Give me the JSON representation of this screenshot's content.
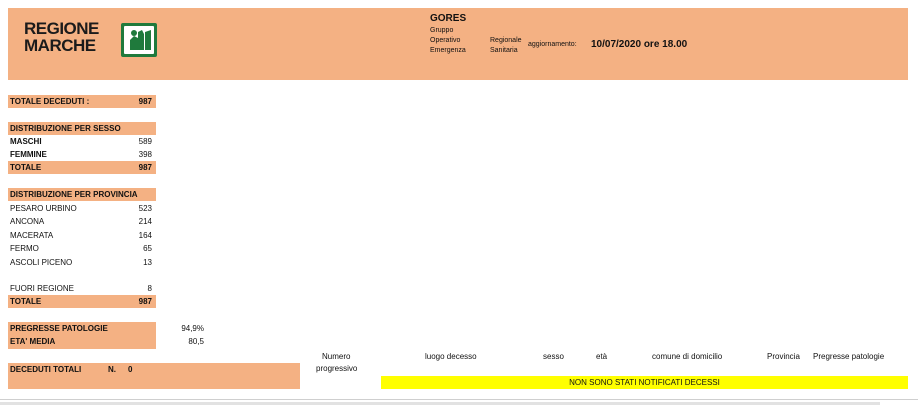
{
  "header": {
    "logo_line1": "REGIONE",
    "logo_line2": "MARCHE",
    "title": "GORES",
    "col1": [
      "Gruppo",
      "Operativo",
      "Emergenza"
    ],
    "col2": [
      "Regionale",
      "Sanitaria"
    ],
    "update_label": "aggiornamento:",
    "update_value": "10/07/2020 ore 18.00"
  },
  "totale_deceduti": {
    "label": "TOTALE DECEDUTI :",
    "value": "987"
  },
  "sesso": {
    "title": "DISTRIBUZIONE PER SESSO",
    "rows": [
      {
        "label": "MASCHI",
        "value": "589"
      },
      {
        "label": "FEMMINE",
        "value": "398"
      }
    ],
    "total": {
      "label": "TOTALE",
      "value": "987"
    }
  },
  "provincia": {
    "title": "DISTRIBUZIONE PER PROVINCIA",
    "rows": [
      {
        "label": "PESARO URBINO",
        "value": "523"
      },
      {
        "label": "ANCONA",
        "value": "214"
      },
      {
        "label": "MACERATA",
        "value": "164"
      },
      {
        "label": "FERMO",
        "value": "65"
      },
      {
        "label": "ASCOLI PICENO",
        "value": "13"
      }
    ],
    "fuori": {
      "label": "FUORI REGIONE",
      "value": "8"
    },
    "total": {
      "label": "TOTALE",
      "value": "987"
    }
  },
  "stats": {
    "patologie": {
      "label": "PREGRESSE PATOLOGIE",
      "value": "94,9%"
    },
    "eta": {
      "label": "ETA' MEDIA",
      "value": "80,5"
    }
  },
  "deceduti_totali": {
    "label": "DECEDUTI TOTALI",
    "n_label": "N.",
    "n_value": "0"
  },
  "table": {
    "headers": {
      "numero": "Numero",
      "progressivo": "progressivo",
      "luogo": "luogo decesso",
      "sesso": "sesso",
      "eta": "età",
      "comune": "comune di domicilio",
      "provincia": "Provincia",
      "patologie": "Pregresse patologie"
    },
    "empty_message": "NON SONO STATI NOTIFICATI DECESSI"
  },
  "colors": {
    "accent": "#f4b183",
    "highlight": "#ffff00",
    "logo_green": "#1f7a3c"
  }
}
